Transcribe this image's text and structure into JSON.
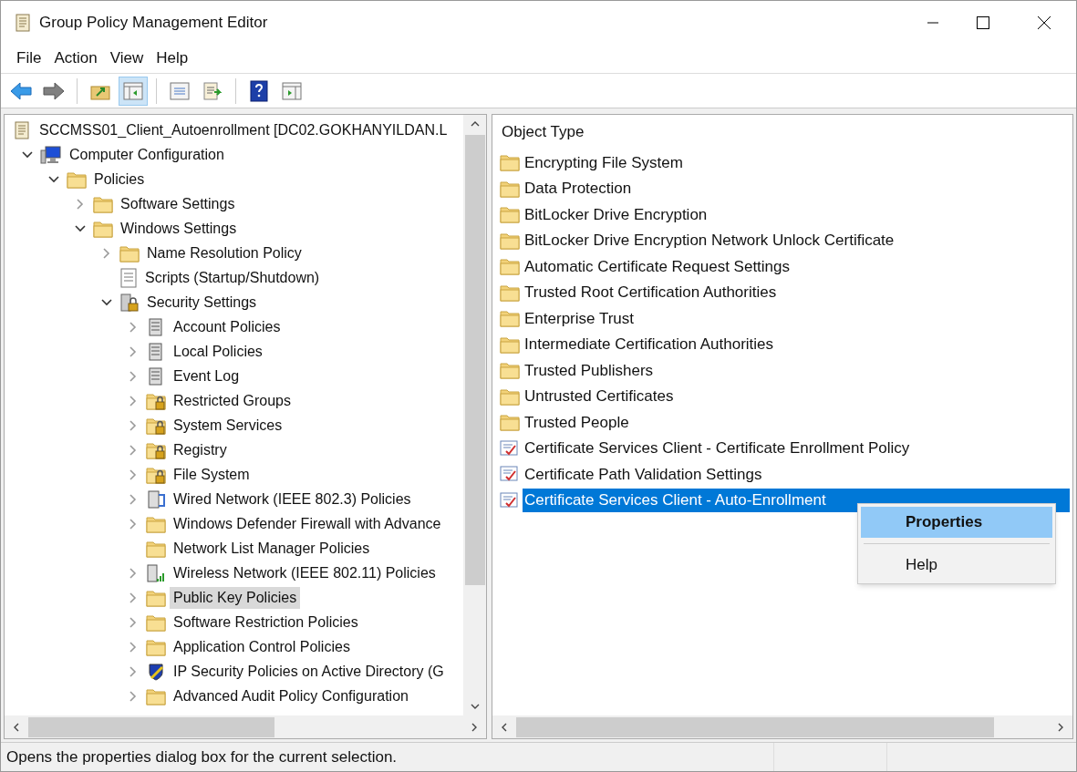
{
  "window": {
    "title": "Group Policy Management Editor"
  },
  "menu": [
    "File",
    "Action",
    "View",
    "Help"
  ],
  "toolbar": [
    {
      "kind": "back"
    },
    {
      "kind": "forward"
    },
    {
      "kind": "sep"
    },
    {
      "kind": "up"
    },
    {
      "kind": "tree",
      "selected": true
    },
    {
      "kind": "sep"
    },
    {
      "kind": "properties"
    },
    {
      "kind": "export"
    },
    {
      "kind": "sep"
    },
    {
      "kind": "help"
    },
    {
      "kind": "action"
    }
  ],
  "tree": {
    "label": "SCCMSS01_Client_Autoenrollment [DC02.GOKHANYILDAN.L",
    "kind": "scroll",
    "selected": false,
    "children": [
      {
        "label": "Computer Configuration",
        "kind": "computer",
        "expandable": true,
        "expanded": true,
        "selected": false,
        "children": [
          {
            "label": "Policies",
            "kind": "folder",
            "expandable": true,
            "expanded": true,
            "selected": false,
            "children": [
              {
                "label": "Software Settings",
                "kind": "folder",
                "expandable": true,
                "expanded": false,
                "selected": false
              },
              {
                "label": "Windows Settings",
                "kind": "folder",
                "expandable": true,
                "expanded": true,
                "selected": false,
                "children": [
                  {
                    "label": "Name Resolution Policy",
                    "kind": "folder",
                    "expandable": true,
                    "expanded": false,
                    "selected": false
                  },
                  {
                    "label": "Scripts (Startup/Shutdown)",
                    "kind": "script",
                    "expandable": false,
                    "selected": false
                  },
                  {
                    "label": "Security Settings",
                    "kind": "security",
                    "expandable": true,
                    "expanded": true,
                    "selected": false,
                    "children": [
                      {
                        "label": "Account Policies",
                        "kind": "server",
                        "expandable": true,
                        "expanded": false,
                        "selected": false
                      },
                      {
                        "label": "Local Policies",
                        "kind": "server",
                        "expandable": true,
                        "expanded": false,
                        "selected": false
                      },
                      {
                        "label": "Event Log",
                        "kind": "server",
                        "expandable": true,
                        "expanded": false,
                        "selected": false
                      },
                      {
                        "label": "Restricted Groups",
                        "kind": "lockfolder",
                        "expandable": true,
                        "expanded": false,
                        "selected": false
                      },
                      {
                        "label": "System Services",
                        "kind": "lockfolder",
                        "expandable": true,
                        "expanded": false,
                        "selected": false
                      },
                      {
                        "label": "Registry",
                        "kind": "lockfolder",
                        "expandable": true,
                        "expanded": false,
                        "selected": false
                      },
                      {
                        "label": "File System",
                        "kind": "lockfolder",
                        "expandable": true,
                        "expanded": false,
                        "selected": false
                      },
                      {
                        "label": "Wired Network (IEEE 802.3) Policies",
                        "kind": "network",
                        "expandable": true,
                        "expanded": false,
                        "selected": false
                      },
                      {
                        "label": "Windows Defender Firewall with Advance",
                        "kind": "folder",
                        "expandable": true,
                        "expanded": false,
                        "selected": false
                      },
                      {
                        "label": "Network List Manager Policies",
                        "kind": "folder",
                        "expandable": false,
                        "selected": false
                      },
                      {
                        "label": "Wireless Network (IEEE 802.11) Policies",
                        "kind": "wireless",
                        "expandable": true,
                        "expanded": false,
                        "selected": false
                      },
                      {
                        "label": "Public Key Policies",
                        "kind": "folder",
                        "expandable": true,
                        "expanded": false,
                        "selected": true
                      },
                      {
                        "label": "Software Restriction Policies",
                        "kind": "folder",
                        "expandable": true,
                        "expanded": false,
                        "selected": false
                      },
                      {
                        "label": "Application Control Policies",
                        "kind": "folder",
                        "expandable": true,
                        "expanded": false,
                        "selected": false
                      },
                      {
                        "label": "IP Security Policies on Active Directory (G",
                        "kind": "ipsec",
                        "expandable": true,
                        "expanded": false,
                        "selected": false
                      },
                      {
                        "label": "Advanced Audit Policy Configuration",
                        "kind": "folder",
                        "expandable": true,
                        "expanded": false,
                        "selected": false
                      }
                    ]
                  }
                ]
              }
            ]
          }
        ]
      }
    ]
  },
  "list": {
    "column": "Object Type",
    "items": [
      {
        "label": "Encrypting File System",
        "kind": "folder",
        "selected": false
      },
      {
        "label": "Data Protection",
        "kind": "folder",
        "selected": false
      },
      {
        "label": "BitLocker Drive Encryption",
        "kind": "folder",
        "selected": false
      },
      {
        "label": "BitLocker Drive Encryption Network Unlock Certificate",
        "kind": "folder",
        "selected": false
      },
      {
        "label": "Automatic Certificate Request Settings",
        "kind": "folder",
        "selected": false
      },
      {
        "label": "Trusted Root Certification Authorities",
        "kind": "folder",
        "selected": false
      },
      {
        "label": "Enterprise Trust",
        "kind": "folder",
        "selected": false
      },
      {
        "label": "Intermediate Certification Authorities",
        "kind": "folder",
        "selected": false
      },
      {
        "label": "Trusted Publishers",
        "kind": "folder",
        "selected": false
      },
      {
        "label": "Untrusted Certificates",
        "kind": "folder",
        "selected": false
      },
      {
        "label": "Trusted People",
        "kind": "folder",
        "selected": false
      },
      {
        "label": "Certificate Services Client - Certificate Enrollment Policy",
        "kind": "certificate",
        "selected": false
      },
      {
        "label": "Certificate Path Validation Settings",
        "kind": "certificate",
        "selected": false
      },
      {
        "label": "Certificate Services Client - Auto-Enrollment",
        "kind": "certificate",
        "selected": true
      }
    ]
  },
  "context_menu": [
    {
      "label": "Properties",
      "kind": "item",
      "selected": true
    },
    {
      "kind": "separator"
    },
    {
      "label": "Help",
      "kind": "item",
      "selected": false
    }
  ],
  "status_bar": "Opens the properties dialog box for the current selection."
}
